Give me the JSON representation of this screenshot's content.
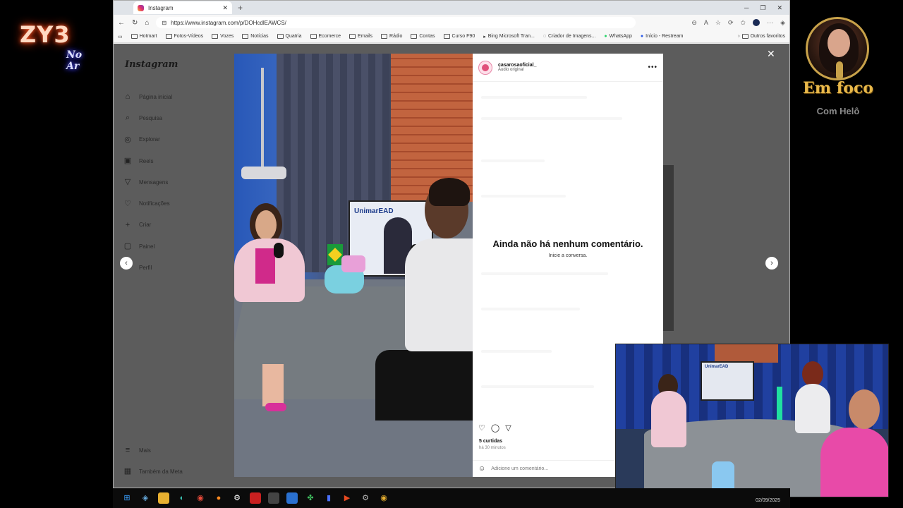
{
  "overlay": {
    "zy3_logo": "ZY3",
    "zy3_sub": "No Ar",
    "emfoco_title": "Em foco",
    "emfoco_sub": "Com Helô"
  },
  "browser": {
    "tab_title": "Instagram",
    "url": "https://www.instagram.com/p/DOHcdlEAWCS/",
    "bookmarks": [
      "Hotmart",
      "Fotos-Vídeos",
      "Vozes",
      "Notícias",
      "Quatria",
      "Ecomerce",
      "Emails",
      "Rádio",
      "Contas",
      "Curso F90",
      "Bing Microsoft Tran...",
      "Criador de Imagens...",
      "WhatsApp",
      "Início - Restream"
    ],
    "other_favorites": "Outros favoritos"
  },
  "instagram": {
    "logo": "Instagram",
    "nav": [
      {
        "label": "Página inicial",
        "icon": "home-icon"
      },
      {
        "label": "Pesquisa",
        "icon": "search-icon"
      },
      {
        "label": "Explorar",
        "icon": "compass-icon"
      },
      {
        "label": "Reels",
        "icon": "reels-icon"
      },
      {
        "label": "Mensagens",
        "icon": "send-icon"
      },
      {
        "label": "Notificações",
        "icon": "heart-icon"
      },
      {
        "label": "Criar",
        "icon": "plus-icon"
      },
      {
        "label": "Painel",
        "icon": "dashboard-icon"
      },
      {
        "label": "Perfil",
        "icon": "profile-icon"
      }
    ],
    "bottom_nav": [
      {
        "label": "Mais",
        "icon": "menu-icon"
      },
      {
        "label": "Também da Meta",
        "icon": "meta-icon"
      }
    ]
  },
  "post": {
    "tv_brand": "UnimarEAD",
    "username": "casarosaoficial_",
    "audio": "Áudio original",
    "empty_title": "Ainda não há nenhum comentário.",
    "empty_sub": "Inicie a conversa.",
    "likes": "5 curtidas",
    "time_ago": "há 30 minutos",
    "comment_placeholder": "Adicione um comentário..."
  },
  "webcam": {
    "tv_brand": "UnimarEAD"
  },
  "taskbar": {
    "date": "02/09/2025"
  }
}
